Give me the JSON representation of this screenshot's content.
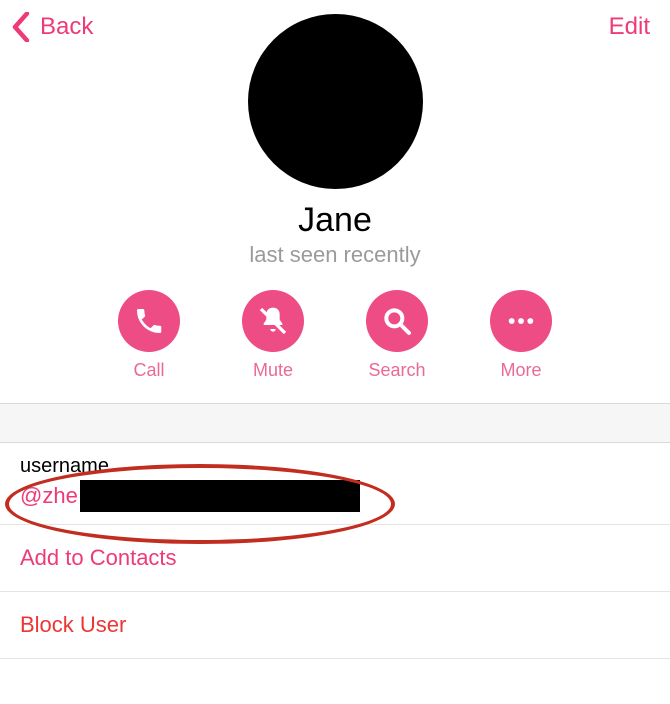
{
  "header": {
    "back_label": "Back",
    "edit_label": "Edit"
  },
  "profile": {
    "name": "Jane",
    "status": "last seen recently"
  },
  "actions": {
    "call": "Call",
    "mute": "Mute",
    "search": "Search",
    "more": "More"
  },
  "info": {
    "username_label": "username",
    "username_value": "@zhe",
    "add_contacts": "Add to Contacts",
    "block_user": "Block User"
  }
}
